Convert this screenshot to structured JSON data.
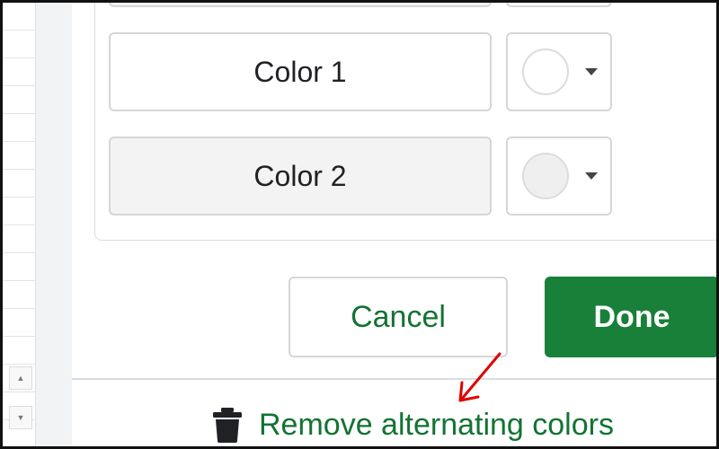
{
  "rows": [
    {
      "label": "Color 1",
      "fill": "#ffffff",
      "swatch": "#ffffff"
    },
    {
      "label": "Color 2",
      "fill": "#f3f3f3",
      "swatch": "#efefef"
    }
  ],
  "buttons": {
    "cancel_label": "Cancel",
    "done_label": "Done"
  },
  "remove": {
    "label": "Remove alternating colors",
    "icon": "trash-icon"
  },
  "colors": {
    "accent": "#188038",
    "link": "#137333",
    "border": "#d6d6d6",
    "annotation_arrow": "#e00000"
  },
  "annotation": {
    "icon": "red-arrow-icon"
  }
}
